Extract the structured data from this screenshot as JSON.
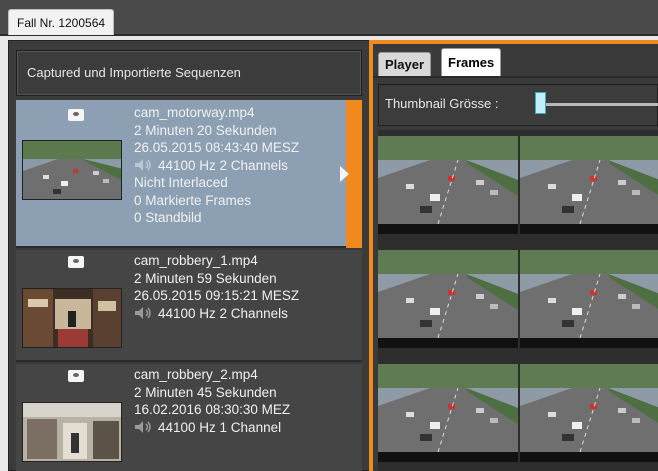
{
  "case_tab": {
    "label": "Fall Nr. 1200564"
  },
  "left": {
    "header": "Captured und Importierte Sequenzen",
    "items": [
      {
        "filename": "cam_motorway.mp4",
        "duration": "2 Minuten 20 Sekunden",
        "datetime": "26.05.2015 08:43:40 MESZ",
        "audio": "44100 Hz 2 Channels",
        "interlace": "Nicht Interlaced",
        "marked": "0 Markierte Frames",
        "stills": "0 Standbild",
        "thumb": "motorway"
      },
      {
        "filename": "cam_robbery_1.mp4",
        "duration": "2 Minuten 59 Sekunden",
        "datetime": "26.05.2015 09:15:21 MESZ",
        "audio": "44100 Hz 2 Channels",
        "thumb": "shop"
      },
      {
        "filename": "cam_robbery_2.mp4",
        "duration": "2 Minuten 45 Sekunden",
        "datetime": "16.02.2016 08:30:30 MEZ",
        "audio": "44100 Hz 1 Channel",
        "thumb": "store"
      }
    ]
  },
  "right": {
    "tabs": {
      "player": "Player",
      "frames": "Frames"
    },
    "thumbnail_label": "Thumbnail Grösse :"
  },
  "colors": {
    "accent_orange": "#f08a1f",
    "selected_item": "#8da0b3",
    "panel_dark": "#3b3b3b"
  },
  "icons": [
    "drive-icon",
    "speaker-icon",
    "selection-arrow-icon"
  ]
}
